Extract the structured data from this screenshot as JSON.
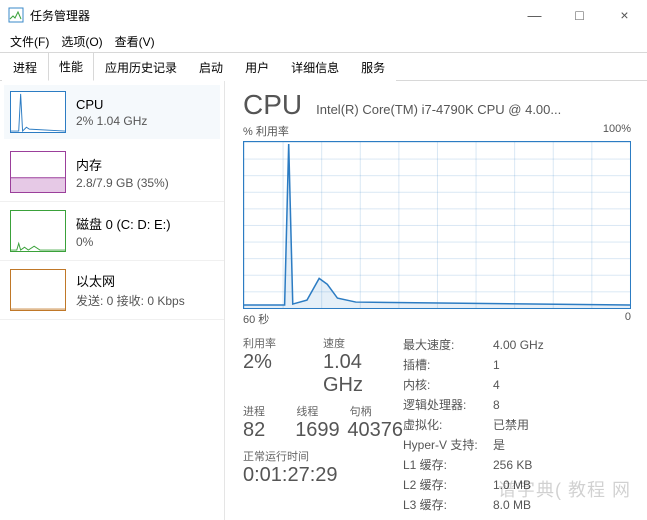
{
  "window": {
    "title": "任务管理器",
    "minimize": "—",
    "maximize": "□",
    "close": "×"
  },
  "menu": {
    "file": "文件(F)",
    "options": "选项(O)",
    "view": "查看(V)"
  },
  "tabs": {
    "processes": "进程",
    "performance": "性能",
    "app_history": "应用历史记录",
    "startup": "启动",
    "users": "用户",
    "details": "详细信息",
    "services": "服务"
  },
  "sidebar": {
    "cpu": {
      "title": "CPU",
      "sub": "2% 1.04 GHz"
    },
    "memory": {
      "title": "内存",
      "sub": "2.8/7.9 GB (35%)"
    },
    "disk": {
      "title": "磁盘 0 (C: D: E:)",
      "sub": "0%"
    },
    "ethernet": {
      "title": "以太网",
      "sub": "发送: 0 接收: 0 Kbps"
    }
  },
  "cpu": {
    "heading": "CPU",
    "model": "Intel(R) Core(TM) i7-4790K CPU @ 4.00...",
    "util_label": "% 利用率",
    "util_max": "100%",
    "time_span": "60 秒",
    "time_zero": "0",
    "labels": {
      "utilization": "利用率",
      "speed": "速度",
      "processes": "进程",
      "threads": "线程",
      "handles": "句柄",
      "uptime": "正常运行时间",
      "max_speed": "最大速度:",
      "sockets": "插槽:",
      "cores": "内核:",
      "logical": "逻辑处理器:",
      "virtualization": "虚拟化:",
      "hyperv": "Hyper-V 支持:",
      "l1": "L1 缓存:",
      "l2": "L2 缓存:",
      "l3": "L3 缓存:"
    },
    "values": {
      "utilization": "2%",
      "speed": "1.04 GHz",
      "processes": "82",
      "threads": "1699",
      "handles": "40376",
      "uptime": "0:01:27:29",
      "max_speed": "4.00 GHz",
      "sockets": "1",
      "cores": "4",
      "logical": "8",
      "virtualization": "已禁用",
      "hyperv": "是",
      "l1": "256 KB",
      "l2": "1.0 MB",
      "l3": "8.0 MB"
    }
  },
  "watermark": "谱字典( 教程 网",
  "chart_data": {
    "type": "line",
    "title": "% 利用率",
    "xlabel": "60 秒",
    "ylabel": "% 利用率",
    "ylim": [
      0,
      100
    ],
    "x_seconds": [
      60,
      58,
      56,
      54,
      52,
      50,
      48,
      46,
      44,
      42,
      40,
      38,
      36,
      34,
      32,
      30,
      28,
      26,
      24,
      22,
      20,
      18,
      16,
      14,
      12,
      10,
      8,
      6,
      4,
      2,
      0
    ],
    "values_percent": [
      2,
      2,
      2,
      2,
      2,
      100,
      3,
      3,
      6,
      18,
      14,
      6,
      3,
      2,
      2,
      2,
      2,
      2,
      2,
      2,
      2,
      2,
      2,
      2,
      2,
      2,
      2,
      2,
      2,
      2,
      2
    ]
  }
}
